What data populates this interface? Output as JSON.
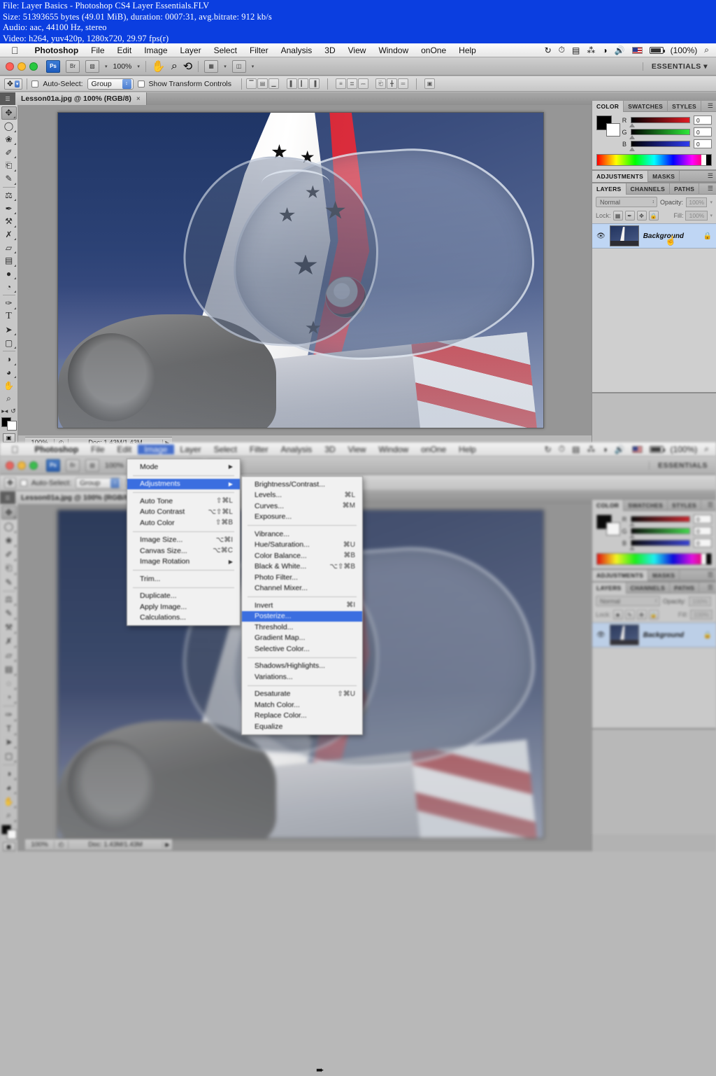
{
  "video_info": {
    "line1": "File: Layer Basics - Photoshop CS4 Layer Essentials.FLV",
    "line2": "Size: 51393655 bytes (49.01 MiB), duration: 0007:31, avg.bitrate: 912 kb/s",
    "line3": "Audio: aac, 44100 Hz, stereo",
    "line4": "Video: h264, yuv420p, 1280x720, 29.97 fps(r)"
  },
  "os_menubar": {
    "apple": "",
    "app_name": "Photoshop",
    "items": [
      "File",
      "Edit",
      "Image",
      "Layer",
      "Select",
      "Filter",
      "Analysis",
      "3D",
      "View",
      "Window",
      "onOne",
      "Help"
    ],
    "highlighted": "Image",
    "status_icons": [
      "sync-icon",
      "timemachine-icon",
      "display-icon",
      "bluetooth-icon",
      "wifi-icon",
      "volume-icon",
      "flag-icon",
      "battery-icon"
    ],
    "battery_percent": "(100%)",
    "spotlight": "search-icon"
  },
  "app_bar": {
    "ps_badge": "Ps",
    "bridge_badge": "Br",
    "view_extras": "view-extras-icon",
    "zoom_level": "100%",
    "hand_tool": "hand-icon",
    "zoom_tool": "zoom-icon",
    "rotate_view": "rotate-view-icon",
    "arrange_docs": "arrange-documents-icon",
    "screen_mode": "screen-mode-icon",
    "workspace": "ESSENTIALS"
  },
  "options_bar": {
    "tool": "move-tool-icon",
    "auto_select_label": "Auto-Select:",
    "auto_select_value": "Group",
    "auto_select_checked": false,
    "show_transform_label": "Show Transform Controls",
    "show_transform_checked": false,
    "align_group_1": [
      "align-top-edges",
      "align-vertical-centers",
      "align-bottom-edges"
    ],
    "align_group_2": [
      "align-left-edges",
      "align-horizontal-centers",
      "align-right-edges"
    ],
    "distribute_group_1": [
      "distribute-top-edges",
      "distribute-vertical-centers",
      "distribute-bottom-edges"
    ],
    "distribute_group_2": [
      "distribute-left-edges",
      "distribute-horizontal-centers",
      "distribute-right-edges"
    ],
    "auto_align": "auto-align-layers-icon"
  },
  "document_tab": {
    "title": "Lesson01a.jpg @ 100% (RGB/8)",
    "close": "×"
  },
  "toolbox": {
    "tools": [
      {
        "name": "move-tool",
        "glyph": "✥",
        "selected": true
      },
      {
        "name": "elliptical-marquee-tool",
        "glyph": "◯",
        "selected": false
      },
      {
        "name": "lasso-tool",
        "glyph": "❀",
        "selected": false
      },
      {
        "name": "quick-selection-tool",
        "glyph": "✐",
        "selected": false
      },
      {
        "name": "crop-tool",
        "glyph": "⌗",
        "selected": false
      },
      {
        "name": "eyedropper-tool",
        "glyph": "✒",
        "selected": false
      },
      {
        "name": "healing-brush-tool",
        "glyph": "⚖",
        "selected": false
      },
      {
        "name": "brush-tool",
        "glyph": "✎",
        "selected": false
      },
      {
        "name": "clone-stamp-tool",
        "glyph": "⚒",
        "selected": false
      },
      {
        "name": "history-brush-tool",
        "glyph": "✇",
        "selected": false
      },
      {
        "name": "eraser-tool",
        "glyph": "▱",
        "selected": false
      },
      {
        "name": "gradient-tool",
        "glyph": "▤",
        "selected": false
      },
      {
        "name": "blur-tool",
        "glyph": "◌",
        "selected": false
      },
      {
        "name": "dodge-tool",
        "glyph": "◔",
        "selected": false
      },
      {
        "name": "pen-tool",
        "glyph": "✑",
        "selected": false
      },
      {
        "name": "type-tool",
        "glyph": "T",
        "selected": false
      },
      {
        "name": "path-selection-tool",
        "glyph": "➤",
        "selected": false
      },
      {
        "name": "rounded-rectangle-tool",
        "glyph": "▢",
        "selected": false
      },
      {
        "name": "3d-rotate-tool",
        "glyph": "◑",
        "selected": false
      },
      {
        "name": "3d-orbit-tool",
        "glyph": "◕",
        "selected": false
      },
      {
        "name": "hand-tool",
        "glyph": "✋",
        "selected": false
      },
      {
        "name": "zoom-tool",
        "glyph": "⌕",
        "selected": false
      }
    ],
    "swap_colors": "swap-colors-icon",
    "default_colors": "default-colors-icon",
    "foreground_color": "#000000",
    "background_color": "#ffffff",
    "quick_mask": "quick-mask-icon"
  },
  "status_bar": {
    "zoom": "100%",
    "clock": "◴",
    "doc_info": "Doc: 1.43M/1.43M",
    "arrow": "▶"
  },
  "color_panel": {
    "tabs": [
      "COLOR",
      "SWATCHES",
      "STYLES"
    ],
    "active_tab": "COLOR",
    "channels": [
      {
        "label": "R",
        "value": "0"
      },
      {
        "label": "G",
        "value": "0"
      },
      {
        "label": "B",
        "value": "0"
      }
    ],
    "foreground": "#000000",
    "background": "#ffffff",
    "menu_icon": "panel-menu-icon"
  },
  "adjustments_panel": {
    "tabs": [
      "ADJUSTMENTS",
      "MASKS"
    ],
    "active_tab": "ADJUSTMENTS",
    "menu_icon": "panel-menu-icon"
  },
  "layers_panel": {
    "tabs": [
      "LAYERS",
      "CHANNELS",
      "PATHS"
    ],
    "active_tab": "LAYERS",
    "blend_mode": "Normal",
    "opacity_label": "Opacity:",
    "opacity_value": "100%",
    "lock_label": "Lock:",
    "fill_label": "Fill:",
    "fill_value": "100%",
    "lock_buttons": [
      "lock-transparent-pixels",
      "lock-image-pixels",
      "lock-position",
      "lock-all"
    ],
    "layers": [
      {
        "name": "Background",
        "visible": true,
        "locked": true,
        "selected": true
      }
    ],
    "menu_icon": "panel-menu-icon"
  },
  "image_menu": {
    "title": "Image",
    "items": [
      {
        "label": "Mode",
        "key": "",
        "submenu": true,
        "highlighted": false
      },
      {
        "sep": true
      },
      {
        "label": "Adjustments",
        "key": "",
        "submenu": true,
        "highlighted": true
      },
      {
        "sep": true
      },
      {
        "label": "Auto Tone",
        "key": "⇧⌘L",
        "submenu": false,
        "highlighted": false
      },
      {
        "label": "Auto Contrast",
        "key": "⌥⇧⌘L",
        "submenu": false,
        "highlighted": false
      },
      {
        "label": "Auto Color",
        "key": "⇧⌘B",
        "submenu": false,
        "highlighted": false
      },
      {
        "sep": true
      },
      {
        "label": "Image Size...",
        "key": "⌥⌘I",
        "submenu": false,
        "highlighted": false
      },
      {
        "label": "Canvas Size...",
        "key": "⌥⌘C",
        "submenu": false,
        "highlighted": false
      },
      {
        "label": "Image Rotation",
        "key": "",
        "submenu": true,
        "highlighted": false
      },
      {
        "sep": true
      },
      {
        "label": "Trim...",
        "key": "",
        "submenu": false,
        "highlighted": false
      },
      {
        "sep": true
      },
      {
        "label": "Duplicate...",
        "key": "",
        "submenu": false,
        "highlighted": false
      },
      {
        "label": "Apply Image...",
        "key": "",
        "submenu": false,
        "highlighted": false
      },
      {
        "label": "Calculations...",
        "key": "",
        "submenu": false,
        "highlighted": false
      }
    ]
  },
  "adjustments_submenu": {
    "items": [
      {
        "label": "Brightness/Contrast...",
        "key": "",
        "highlighted": false
      },
      {
        "label": "Levels...",
        "key": "⌘L",
        "highlighted": false
      },
      {
        "label": "Curves...",
        "key": "⌘M",
        "highlighted": false
      },
      {
        "label": "Exposure...",
        "key": "",
        "highlighted": false
      },
      {
        "sep": true
      },
      {
        "label": "Vibrance...",
        "key": "",
        "highlighted": false
      },
      {
        "label": "Hue/Saturation...",
        "key": "⌘U",
        "highlighted": false
      },
      {
        "label": "Color Balance...",
        "key": "⌘B",
        "highlighted": false
      },
      {
        "label": "Black & White...",
        "key": "⌥⇧⌘B",
        "highlighted": false
      },
      {
        "label": "Photo Filter...",
        "key": "",
        "highlighted": false
      },
      {
        "label": "Channel Mixer...",
        "key": "",
        "highlighted": false
      },
      {
        "sep": true
      },
      {
        "label": "Invert",
        "key": "⌘I",
        "highlighted": false
      },
      {
        "label": "Posterize...",
        "key": "",
        "highlighted": true
      },
      {
        "label": "Threshold...",
        "key": "",
        "highlighted": false
      },
      {
        "label": "Gradient Map...",
        "key": "",
        "highlighted": false
      },
      {
        "label": "Selective Color...",
        "key": "",
        "highlighted": false
      },
      {
        "sep": true
      },
      {
        "label": "Shadows/Highlights...",
        "key": "",
        "highlighted": false
      },
      {
        "label": "Variations...",
        "key": "",
        "highlighted": false
      },
      {
        "sep": true
      },
      {
        "label": "Desaturate",
        "key": "⇧⌘U",
        "highlighted": false
      },
      {
        "label": "Match Color...",
        "key": "",
        "highlighted": false
      },
      {
        "label": "Replace Color...",
        "key": "",
        "highlighted": false
      },
      {
        "label": "Equalize",
        "key": "",
        "highlighted": false
      }
    ]
  },
  "colors": {
    "menu_highlight": "#3b6ee0",
    "video_overlay_bg": "#0b3ee0",
    "panel_bg": "#cfcfcf",
    "layer_selected": "#bfd6f4",
    "canvas_surround": "#969696"
  }
}
